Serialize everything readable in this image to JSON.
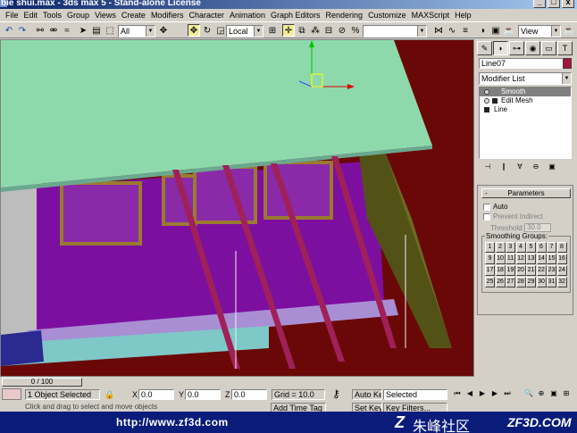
{
  "window": {
    "title": "bie shui.max - 3ds max 5 - Stand-alone License",
    "controls": {
      "minimize": "_",
      "maximize": "□",
      "close": "x"
    }
  },
  "menu": [
    "File",
    "Edit",
    "Tools",
    "Group",
    "Views",
    "Create",
    "Modifiers",
    "Character",
    "Animation",
    "Graph Editors",
    "Rendering",
    "Customize",
    "MAXScript",
    "Help"
  ],
  "toolbar": {
    "selection_filter": "All",
    "reference_coord": "Local",
    "named_selection": "",
    "view_dropdown": "View"
  },
  "command_panel": {
    "object_name": "Line07",
    "object_color": "#a4143c",
    "modifier_list": "Modifier List",
    "stack": [
      {
        "label": "Smooth",
        "selected": true
      },
      {
        "label": "Edit Mesh",
        "selected": false
      },
      {
        "label": "Line",
        "selected": false
      }
    ],
    "rollout_title": "Parameters",
    "auto_label": "Auto",
    "prevent_indirect_label": "Prevent Indirect",
    "threshold_label": "Threshold:",
    "threshold_value": "30.0",
    "smoothing_groups_label": "Smoothing Groups:",
    "smoothing_groups": [
      "1",
      "2",
      "3",
      "4",
      "5",
      "6",
      "7",
      "8",
      "9",
      "10",
      "11",
      "12",
      "13",
      "14",
      "15",
      "16",
      "17",
      "18",
      "19",
      "20",
      "21",
      "22",
      "23",
      "24",
      "25",
      "26",
      "27",
      "28",
      "29",
      "30",
      "31",
      "32"
    ]
  },
  "timeline": {
    "frame_label": "0 / 100"
  },
  "status": {
    "selection_count": "1 Object Selected",
    "x_label": "X",
    "x_value": "0.0",
    "y_label": "Y",
    "y_value": "0.0",
    "z_label": "Z",
    "z_value": "0.0",
    "grid": "Grid = 10.0",
    "auto_key": "Auto Key",
    "set_key": "Set Key",
    "key_mode": "Selected",
    "key_filters": "Key Filters...",
    "prompt": "Click and drag to select and move objects",
    "add_time_tag": "Add Time Tag"
  },
  "watermark": {
    "url": "http://www.zf3d.com",
    "logo": "Z",
    "chinese": "朱峰社区",
    "site": "ZF3D.COM"
  }
}
